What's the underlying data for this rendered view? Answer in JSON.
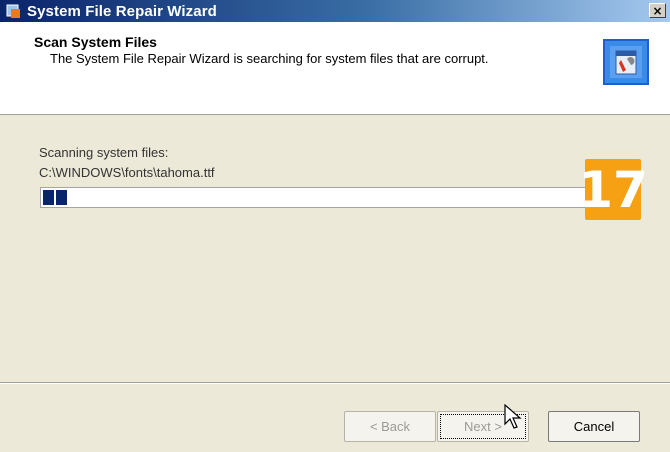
{
  "window": {
    "title": "System File Repair Wizard",
    "close_label": "×"
  },
  "header": {
    "title": "Scan System Files",
    "subtitle": "The System File Repair Wizard is searching for system files that are corrupt.",
    "icon": "wizard-repair-icon"
  },
  "content": {
    "scan_label": "Scanning system files:",
    "current_file": "C:\\WINDOWS\\fonts\\tahoma.ttf",
    "progress_fraction": 0.04
  },
  "badge": {
    "number": "17"
  },
  "buttons": {
    "back": "< Back",
    "next": "Next >",
    "cancel": "Cancel"
  },
  "colors": {
    "accent": "#0a246a",
    "badge": "#f5a113"
  }
}
